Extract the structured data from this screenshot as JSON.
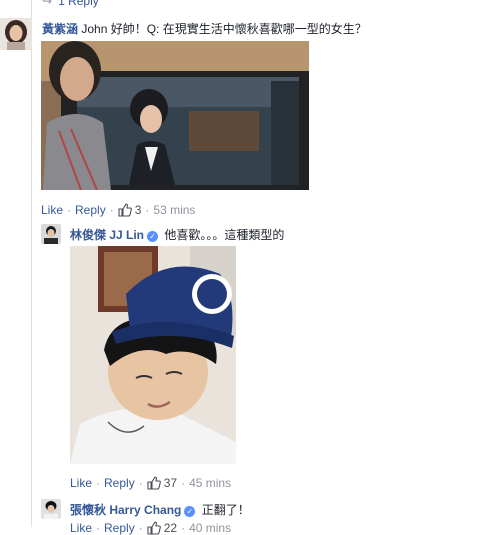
{
  "top_reply": {
    "label": "1 Reply"
  },
  "comment1": {
    "author": "黃紫涵",
    "text": "John 好帥！Q: 在現實生活中懷秋喜歡哪一型的女生？",
    "actions": {
      "like": "Like",
      "reply": "Reply",
      "likes": "3",
      "time": "53 mins"
    }
  },
  "comment2": {
    "author": "林俊傑 JJ Lin",
    "text": "他喜歡。。。這種類型的",
    "actions": {
      "like": "Like",
      "reply": "Reply",
      "likes": "37",
      "time": "45 mins"
    }
  },
  "comment3": {
    "author": "張懷秋 Harry Chang",
    "text": "正翻了！",
    "actions": {
      "like": "Like",
      "reply": "Reply",
      "likes": "22",
      "time": "40 mins"
    }
  },
  "colors": {
    "link": "#365899",
    "verified": "#5890ff",
    "meta": "#90949c"
  },
  "icons": [
    "reply-arrow-icon",
    "like-thumb-icon",
    "verified-badge-icon"
  ]
}
